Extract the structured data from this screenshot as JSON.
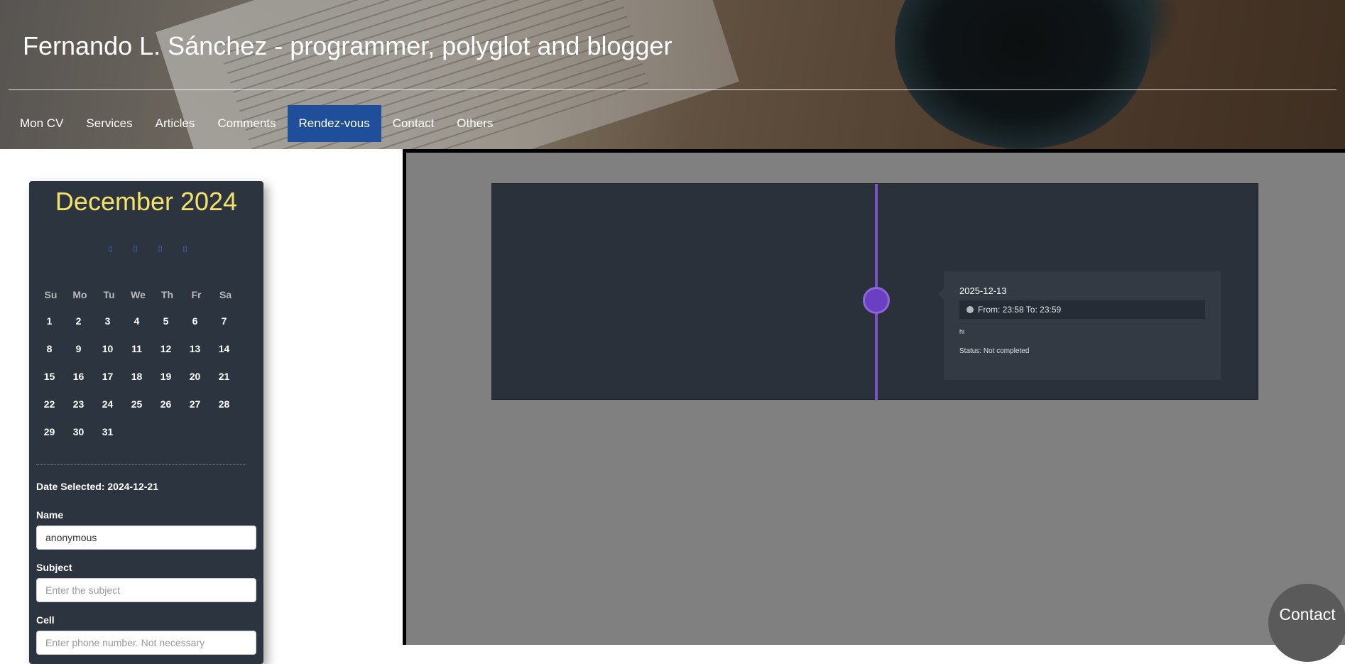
{
  "header": {
    "title": "Fernando L. Sánchez - programmer, polyglot and blogger",
    "nav": [
      {
        "label": "Mon CV"
      },
      {
        "label": "Services"
      },
      {
        "label": "Articles"
      },
      {
        "label": "Comments"
      },
      {
        "label": "Rendez-vous",
        "active": true
      },
      {
        "label": "Contact"
      },
      {
        "label": "Others"
      }
    ]
  },
  "calendar": {
    "title": "December 2024",
    "nav_icons": [
      "first-icon",
      "prev-icon",
      "next-icon",
      "last-icon"
    ],
    "weekdays": [
      "Su",
      "Mo",
      "Tu",
      "We",
      "Th",
      "Fr",
      "Sa"
    ],
    "days": [
      "1",
      "2",
      "3",
      "4",
      "5",
      "6",
      "7",
      "8",
      "9",
      "10",
      "11",
      "12",
      "13",
      "14",
      "15",
      "16",
      "17",
      "18",
      "19",
      "20",
      "21",
      "22",
      "23",
      "24",
      "25",
      "26",
      "27",
      "28",
      "29",
      "30",
      "31"
    ],
    "date_selected": "Date Selected: 2024-12-21",
    "name_label": "Name",
    "name_value": "anonymous",
    "subject_label": "Subject",
    "subject_placeholder": "Enter the subject",
    "cell_label": "Cell",
    "cell_placeholder": "Enter phone number. Not necessary"
  },
  "timeline": {
    "event": {
      "date": "2025-12-13",
      "time": "From: 23:58 To: 23:59",
      "description": "hi",
      "status": "Status: Not completed"
    }
  },
  "contact_button": "Contact",
  "colors": {
    "nav_active": "#1f4f9a",
    "calendar_bg": "#2c3440",
    "calendar_title": "#f3e36b",
    "timeline_accent": "#7b55c7"
  }
}
